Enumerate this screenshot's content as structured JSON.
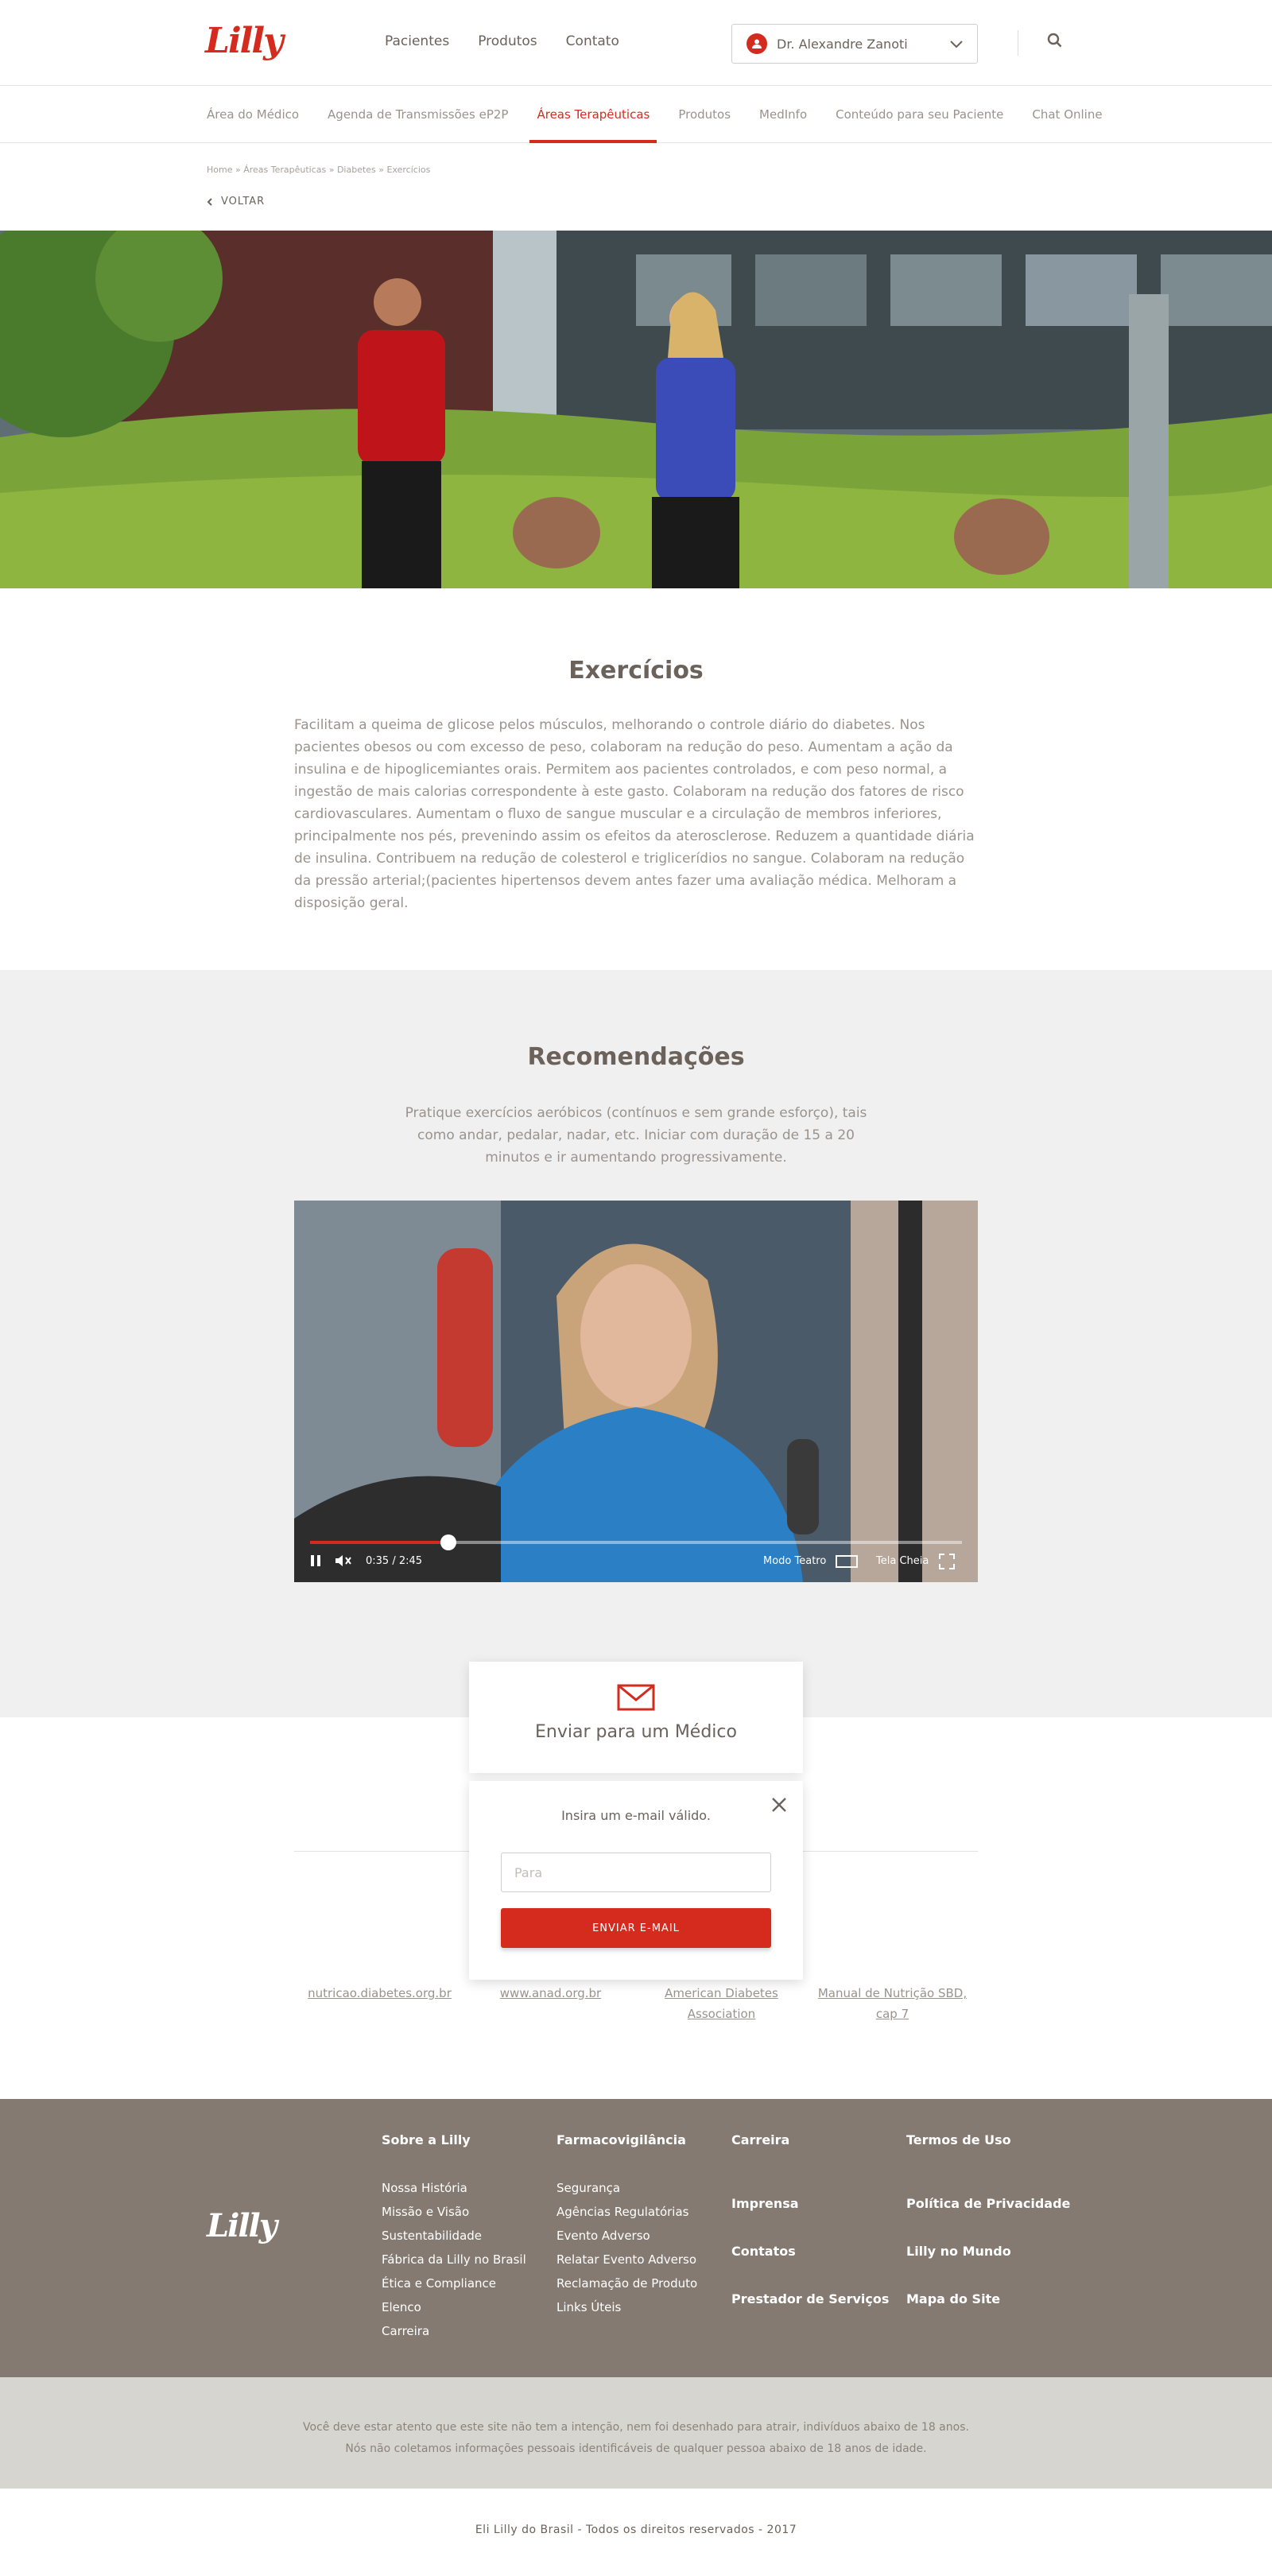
{
  "header": {
    "logo": "Lilly",
    "nav": [
      "Pacientes",
      "Produtos",
      "Contato"
    ],
    "user_name": "Dr. Alexandre Zanoti"
  },
  "subnav": {
    "items": [
      "Área do Médico",
      "Agenda de Transmissões eP2P",
      "Áreas Terapêuticas",
      "Produtos",
      "MedInfo",
      "Conteúdo para seu Paciente",
      "Chat Online"
    ],
    "active_index": 2
  },
  "breadcrumb": "Home » Áreas Terapêuticas » Diabetes » Exercícios",
  "back_label": "VOLTAR",
  "exercicios": {
    "title": "Exercícios",
    "text": "Facilitam a queima de glicose pelos músculos, melhorando o controle diário do diabetes. Nos pacientes obesos ou com excesso de peso, colaboram na redução do peso. Aumentam a ação da insulina e de hipoglicemiantes orais. Permitem aos pacientes controlados, e com peso normal, a ingestão de mais calorias correspondente à este gasto. Colaboram na redução dos fatores de risco cardiovasculares. Aumentam o fluxo de sangue muscular e a circulação de membros inferiores, principalmente nos pés, prevenindo assim os efeitos da aterosclerose. Reduzem a quantidade diária de insulina. Contribuem na redução de colesterol e triglicerídios no sangue. Colaboram na redução da pressão arterial;(pacientes hipertensos devem antes fazer uma avaliação médica. Melhoram a disposição geral."
  },
  "recomendacoes": {
    "title": "Recomendações",
    "text": "Pratique exercícios aeróbicos (contínuos e sem grande esforço), tais como andar, pedalar, nadar, etc. Iniciar com duração de 15 a 20 minutos e ir aumentando progressivamente."
  },
  "video": {
    "time": "0:35 / 2:45",
    "progress": 0.212,
    "theater_label": "Modo Teatro",
    "fullscreen_label": "Tela Cheia"
  },
  "share": {
    "label": "Enviar para um Médico",
    "popup_message": "Insira um e-mail válido.",
    "input_placeholder": "Para",
    "button_label": "ENVIAR E-MAIL"
  },
  "links": [
    "nutricao.diabetes.org.br",
    "www.anad.org.br",
    "American Diabetes Association",
    "Manual de Nutrição SBD, cap 7"
  ],
  "footer": {
    "logo": "Lilly",
    "col1": {
      "title": "Sobre a Lilly",
      "items": [
        "Nossa História",
        "Missão e Visão",
        "Sustentabilidade",
        "Fábrica da Lilly no Brasil",
        "Ética e Compliance",
        "Elenco",
        "Carreira"
      ]
    },
    "col2": {
      "title": "Farmacovigilância",
      "items": [
        "Segurança",
        "Agências Regulatórias",
        "Evento Adverso",
        "Relatar Evento Adverso",
        "Reclamação de Produto",
        "Links Úteis"
      ]
    },
    "col3": [
      "Carreira",
      "Imprensa",
      "Contatos",
      "Prestador de Serviços"
    ],
    "col4": [
      "Termos de Uso",
      "Política de Privacidade",
      "Lilly no Mundo",
      "Mapa do Site"
    ]
  },
  "disclaimer": {
    "line1": "Você deve estar atento que este site não tem a intenção, nem foi desenhado para atrair, indivíduos abaixo de 18 anos.",
    "line2": "Nós não coletamos informações pessoais identificáveis de qualquer pessoa abaixo de 18 anos de idade."
  },
  "copyright": "Eli Lilly do Brasil - Todos os direitos reservados - 2017",
  "colors": {
    "brand_red": "#d52b1e",
    "footer_bg": "#857a71",
    "disclaimer_bg": "#d7d5d0",
    "section_gray": "#f0f0f1"
  }
}
